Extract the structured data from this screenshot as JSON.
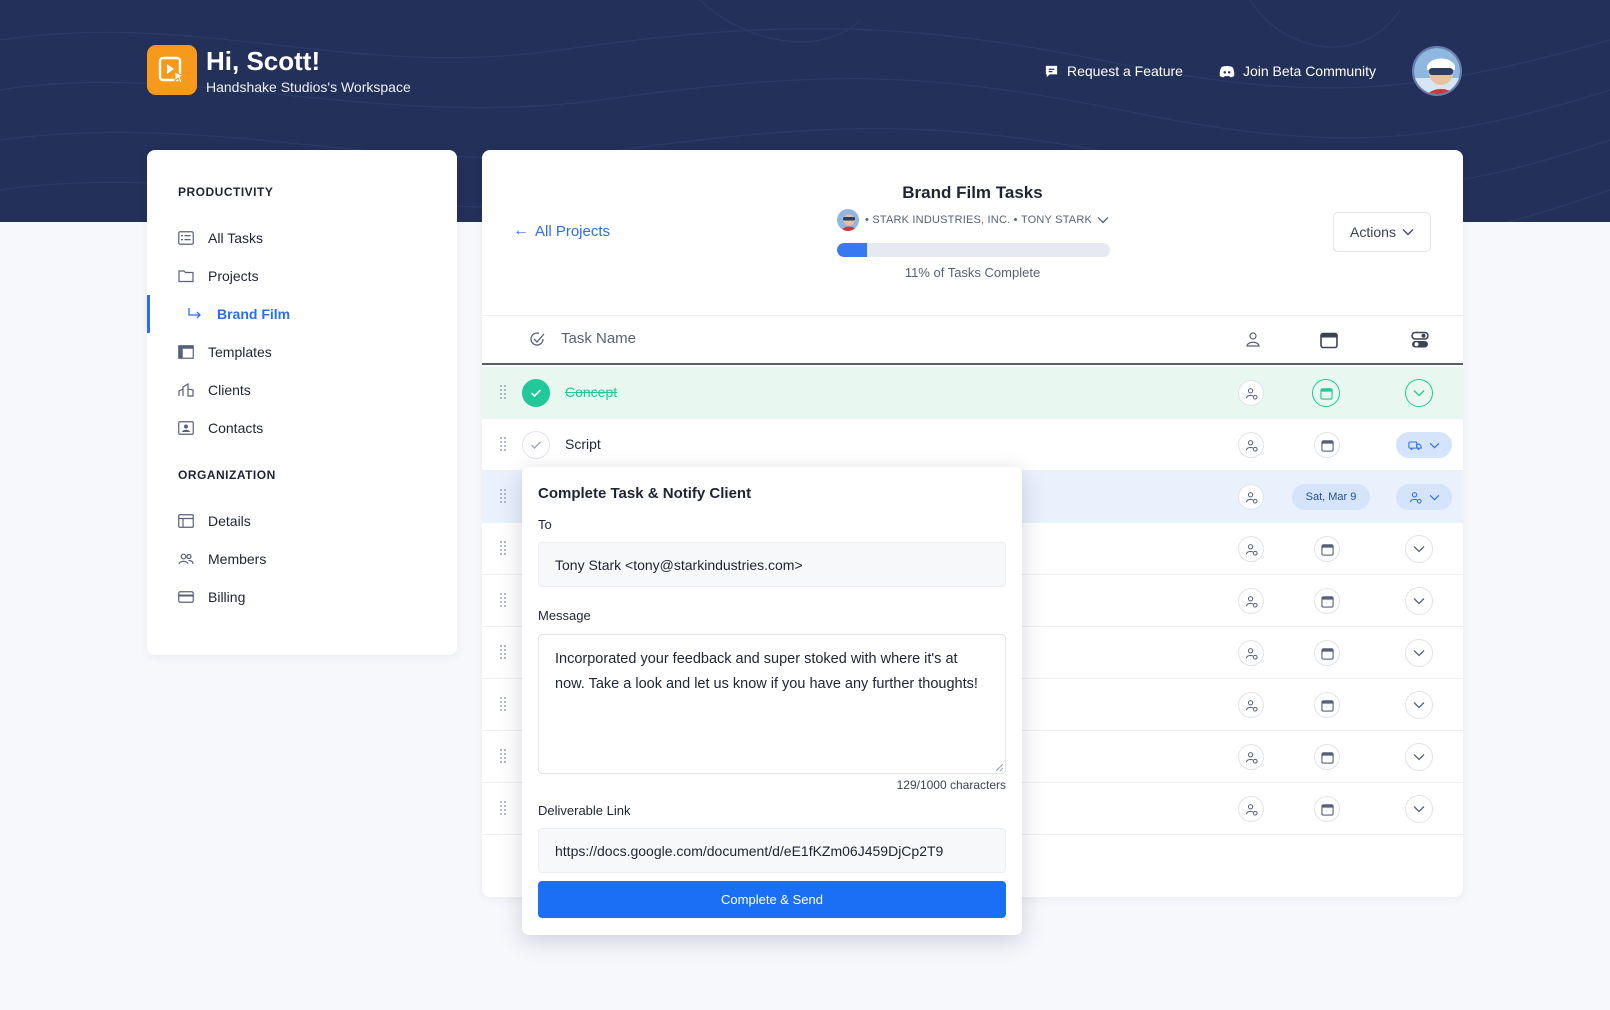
{
  "header": {
    "greeting": "Hi, Scott!",
    "workspace": "Handshake Studios's Workspace",
    "request_feature": "Request a Feature",
    "join_beta": "Join Beta Community"
  },
  "sidebar": {
    "productivity_heading": "PRODUCTIVITY",
    "organization_heading": "ORGANIZATION",
    "items": {
      "all_tasks": "All Tasks",
      "projects": "Projects",
      "brand_film": "Brand Film",
      "templates": "Templates",
      "clients": "Clients",
      "contacts": "Contacts",
      "details": "Details",
      "members": "Members",
      "billing": "Billing"
    }
  },
  "project": {
    "back_label": "All Projects",
    "title": "Brand Film Tasks",
    "client": "STARK INDUSTRIES, INC.",
    "contact": "TONY STARK",
    "progress_fraction": 0.11,
    "progress_label": "11% of Tasks Complete",
    "actions_label": "Actions"
  },
  "table": {
    "header_task_name": "Task Name",
    "rows": [
      {
        "name": "Concept",
        "done": true
      },
      {
        "name": "Script",
        "done": false
      },
      {
        "name": "",
        "done": false,
        "date": "Sat, Mar 9"
      }
    ]
  },
  "popup": {
    "title": "Complete Task & Notify Client",
    "to_label": "To",
    "to_value": "Tony Stark <tony@starkindustries.com>",
    "message_label": "Message",
    "message_value": "Incorporated your feedback and super stoked with where it's at now. Take a look and let us know if you have any further thoughts!",
    "char_count": "129/1000 characters",
    "link_label": "Deliverable Link",
    "link_value": "https://docs.google.com/document/d/eE1fKZm06J459DjCp2T9",
    "send_label": "Complete & Send"
  },
  "colors": {
    "navy": "#23305a",
    "accent": "#2a6ff0",
    "success": "#20c997",
    "logo": "#f79a1c"
  }
}
